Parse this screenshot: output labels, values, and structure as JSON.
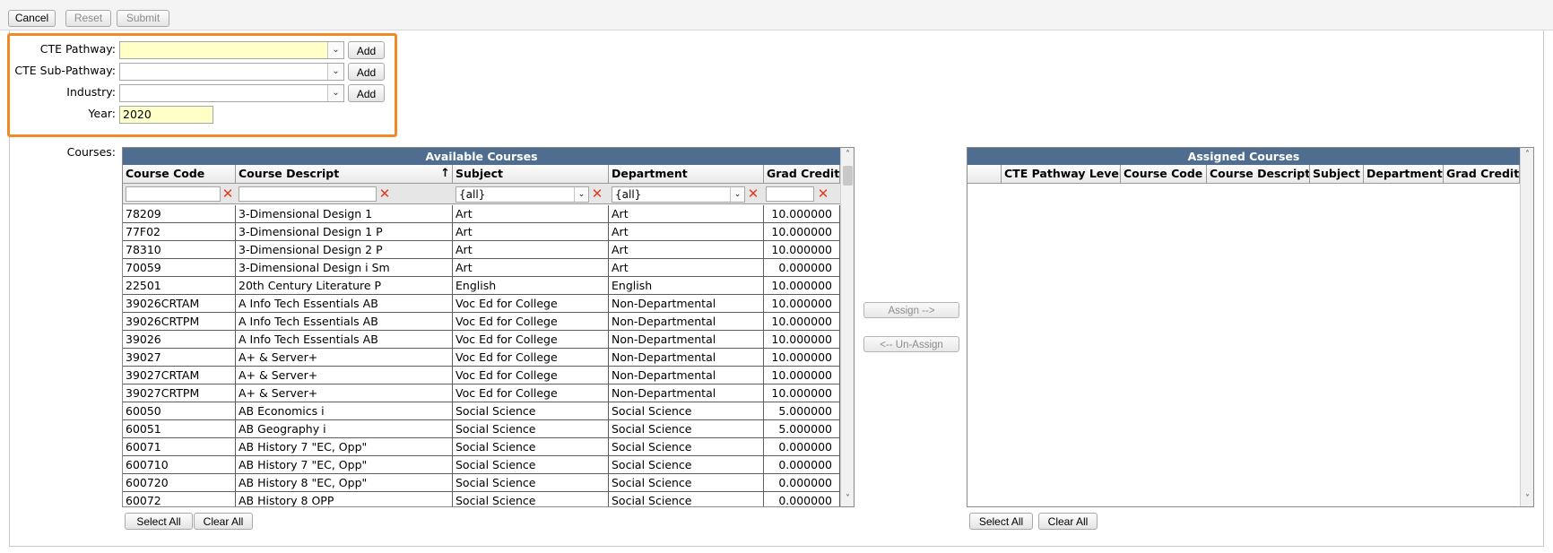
{
  "toolbar": {
    "cancel": "Cancel",
    "reset": "Reset",
    "submit": "Submit"
  },
  "form": {
    "cte_pathway_label": "CTE Pathway:",
    "cte_subpathway_label": "CTE Sub-Pathway:",
    "industry_label": "Industry:",
    "year_label": "Year:",
    "year_value": "2020",
    "add_label": "Add",
    "courses_label": "Courses:"
  },
  "available": {
    "title": "Available Courses",
    "columns": [
      "Course Code",
      "Course Descript",
      "Subject",
      "Department",
      "Grad Credit"
    ],
    "sort_icon": "sort-ascending-arrow",
    "filter_all": "{all}",
    "rows": [
      [
        "78209",
        "3-Dimensional Design 1",
        "Art",
        "Art",
        "10.000000"
      ],
      [
        "77F02",
        "3-Dimensional Design 1 P",
        "Art",
        "Art",
        "10.000000"
      ],
      [
        "78310",
        "3-Dimensional Design 2 P",
        "Art",
        "Art",
        "10.000000"
      ],
      [
        "70059",
        "3-Dimensional Design i Sm",
        "Art",
        "Art",
        "0.000000"
      ],
      [
        "22501",
        "20th Century Literature P",
        "English",
        "English",
        "10.000000"
      ],
      [
        "39026CRTAM",
        "A Info Tech Essentials AB",
        "Voc Ed for College",
        "Non-Departmental",
        "10.000000"
      ],
      [
        "39026CRTPM",
        "A Info Tech Essentials AB",
        "Voc Ed for College",
        "Non-Departmental",
        "10.000000"
      ],
      [
        "39026",
        "A Info Tech Essentials AB",
        "Voc Ed for College",
        "Non-Departmental",
        "10.000000"
      ],
      [
        "39027",
        "A+ & Server+",
        "Voc Ed for College",
        "Non-Departmental",
        "10.000000"
      ],
      [
        "39027CRTAM",
        "A+ & Server+",
        "Voc Ed for College",
        "Non-Departmental",
        "10.000000"
      ],
      [
        "39027CRTPM",
        "A+ & Server+",
        "Voc Ed for College",
        "Non-Departmental",
        "10.000000"
      ],
      [
        "60050",
        "AB Economics i",
        "Social Science",
        "Social Science",
        "5.000000"
      ],
      [
        "60051",
        "AB Geography i",
        "Social Science",
        "Social Science",
        "5.000000"
      ],
      [
        "60071",
        "AB History 7 \"EC, Opp\"",
        "Social Science",
        "Social Science",
        "0.000000"
      ],
      [
        "600710",
        "AB History 7 \"EC, Opp\"",
        "Social Science",
        "Social Science",
        "0.000000"
      ],
      [
        "600720",
        "AB History 8 \"EC, Opp\"",
        "Social Science",
        "Social Science",
        "0.000000"
      ],
      [
        "60072",
        "AB History 8 OPP",
        "Social Science",
        "Social Science",
        "0.000000"
      ]
    ]
  },
  "middle": {
    "assign": "Assign -->",
    "unassign": "<-- Un-Assign"
  },
  "assigned": {
    "title": "Assigned Courses",
    "columns": [
      "",
      "CTE Pathway Level",
      "Course Code",
      "Course Descript",
      "Subject",
      "Department",
      "Grad Credit"
    ]
  },
  "buttons": {
    "select_all": "Select All",
    "clear_all": "Clear All"
  }
}
